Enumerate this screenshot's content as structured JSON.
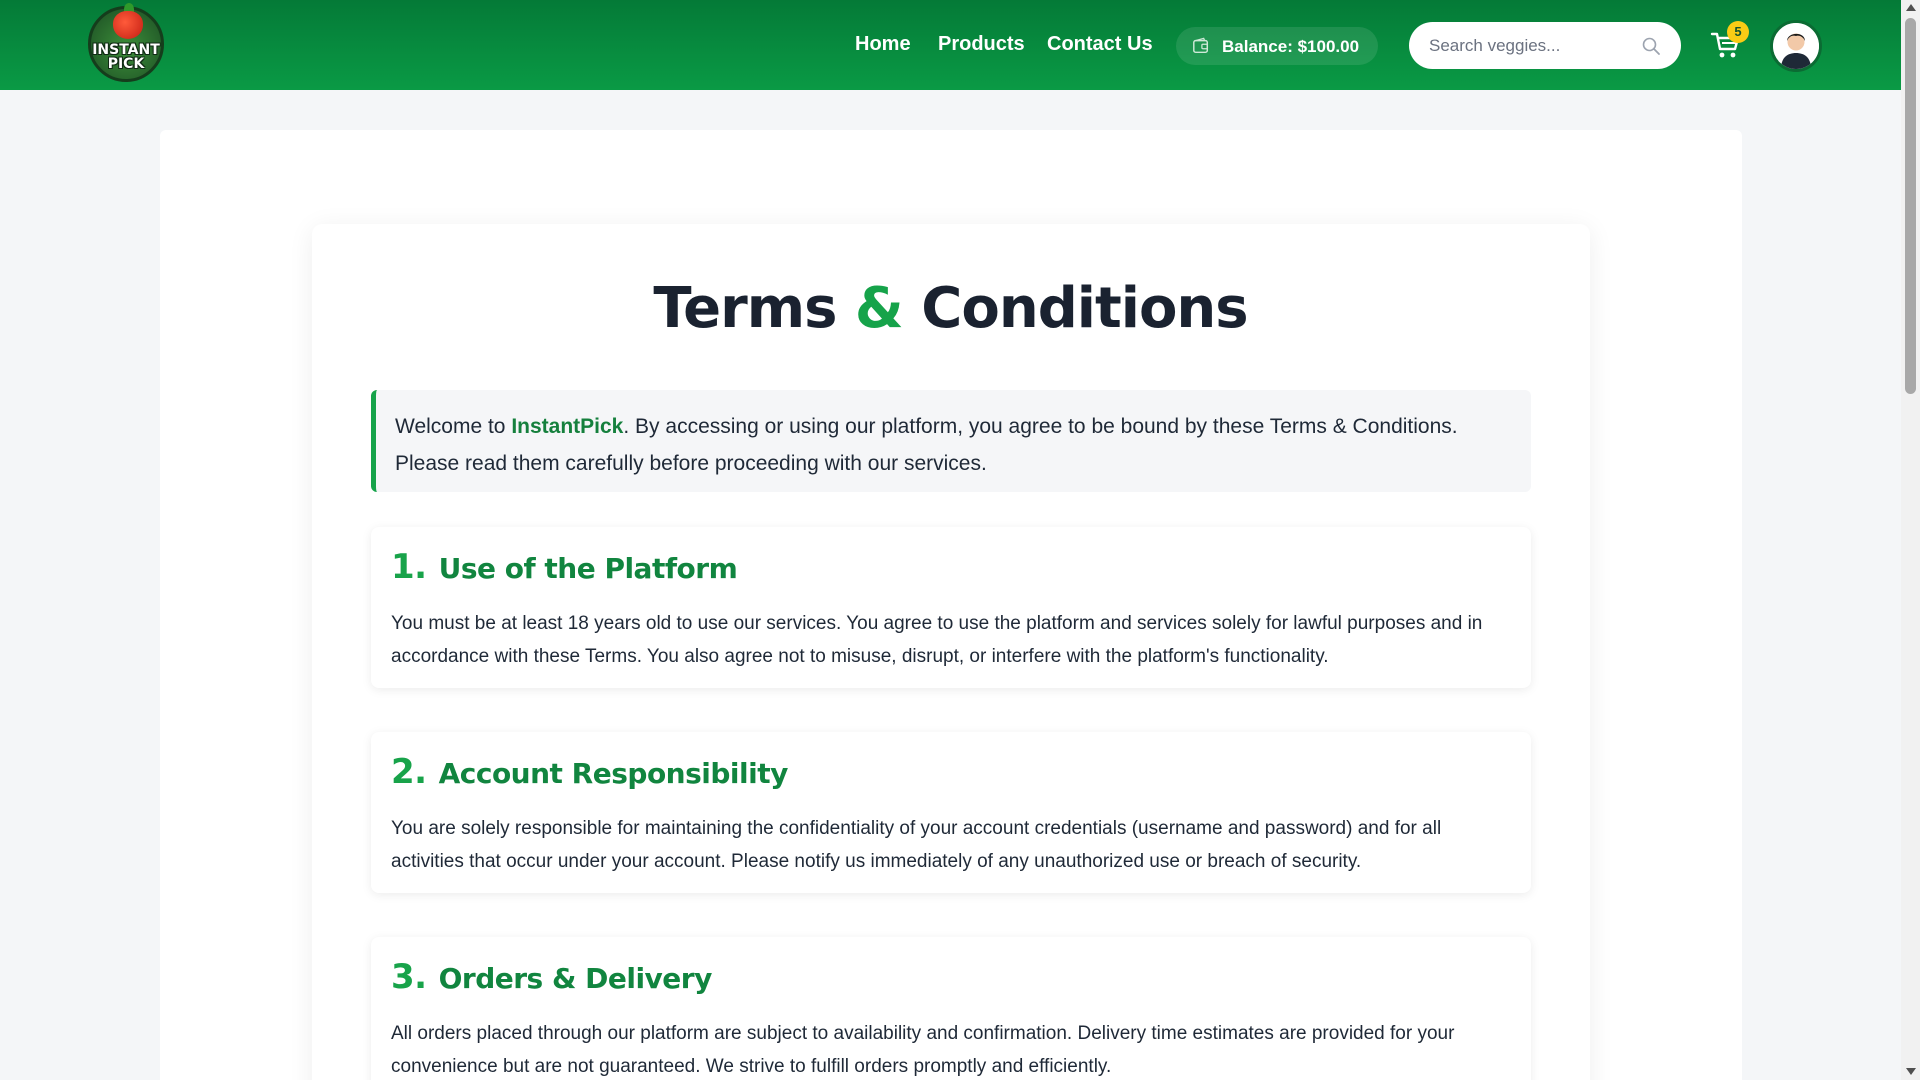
{
  "header": {
    "logo_text": "INSTANT PICK",
    "nav": [
      {
        "label": "Home"
      },
      {
        "label": "Products"
      },
      {
        "label": "Contact Us"
      }
    ],
    "balance_label": "Balance: $100.00",
    "search_placeholder": "Search veggies...",
    "cart_count": "5"
  },
  "page": {
    "title_part1": "Terms",
    "title_amp": "&",
    "title_part2": "Conditions",
    "intro": {
      "before": "Welcome to ",
      "brand": "InstantPick",
      "after": ". By accessing or using our platform, you agree to be bound by these Terms & Conditions. Please read them carefully before proceeding with our services."
    },
    "sections": [
      {
        "number": "1.",
        "title": "Use of the Platform",
        "body": "You must be at least 18 years old to use our services. You agree to use the platform and services solely for lawful purposes and in accordance with these Terms. You also agree not to misuse, disrupt, or interfere with the platform's functionality."
      },
      {
        "number": "2.",
        "title": "Account Responsibility",
        "body": "You are solely responsible for maintaining the confidentiality of your account credentials (username and password) and for all activities that occur under your account. Please notify us immediately of any unauthorized use or breach of security."
      },
      {
        "number": "3.",
        "title": "Orders & Delivery",
        "body": "All orders placed through our platform are subject to availability and confirmation. Delivery time estimates are provided for your convenience but are not guaranteed. We strive to fulfill orders promptly and efficiently."
      }
    ]
  },
  "colors": {
    "brand_green": "#0a9a45",
    "accent_green": "#16a34a",
    "badge_yellow": "#facc15"
  },
  "icons": [
    "wallet-icon",
    "search-icon",
    "cart-icon",
    "user-avatar"
  ]
}
